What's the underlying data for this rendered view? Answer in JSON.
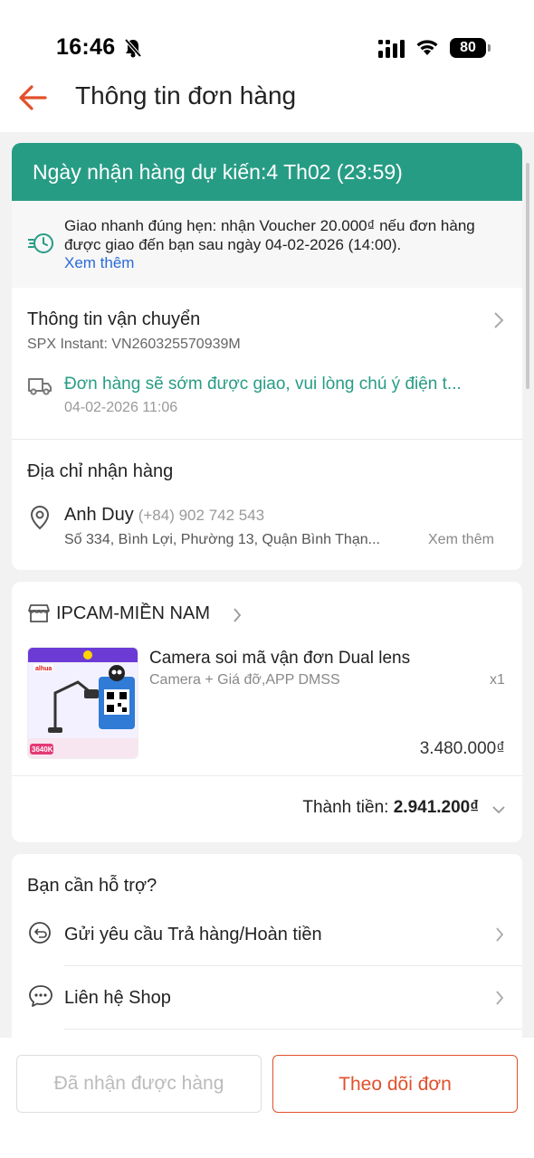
{
  "status_bar": {
    "time": "16:46",
    "battery": "80"
  },
  "header": {
    "title": "Thông tin đơn hàng"
  },
  "delivery": {
    "eta": "Ngày nhận hàng dự kiến:4 Th02 (23:59)",
    "promo_text": "Giao nhanh đúng hẹn: nhận Voucher 20.000₫ nếu đơn hàng được giao đến bạn sau ngày 04-02-2026 (14:00).",
    "promo_link": "Xem thêm"
  },
  "shipping": {
    "title": "Thông tin vận chuyển",
    "carrier": "SPX Instant: VN260325570939M",
    "status": "Đơn hàng sẽ sớm được giao, vui lòng chú ý điện t...",
    "status_time": "04-02-2026 11:06"
  },
  "address": {
    "title": "Địa chỉ nhận hàng",
    "name": "Anh Duy",
    "phone": "(+84) 902 742 543",
    "line": "Số 334, Bình Lợi, Phường 13, Quận Bình Thạn...",
    "more": "Xem thêm"
  },
  "order": {
    "shop_name": "IPCAM-MIỀN NAM",
    "product_name": "Camera soi  mã vận đơn Dual lens",
    "variant": "Camera + Giá đỡ,APP DMSS",
    "qty": "x1",
    "price": "3.480.000₫",
    "total_label": "Thành tiền: ",
    "total_amount": "2.941.200₫",
    "thumb_brand": "alhua",
    "thumb_price": "3640K"
  },
  "support": {
    "title": "Bạn cần hỗ trợ?",
    "items": [
      {
        "label": "Gửi yêu cầu Trả hàng/Hoàn tiền",
        "icon": "return-icon"
      },
      {
        "label": "Liên hệ Shop",
        "icon": "chat-icon"
      }
    ]
  },
  "actions": {
    "received": "Đã nhận được hàng",
    "track": "Theo dõi đơn"
  },
  "colors": {
    "accent": "#e2502b",
    "teal": "#279c85",
    "link": "#2a6ad8"
  }
}
